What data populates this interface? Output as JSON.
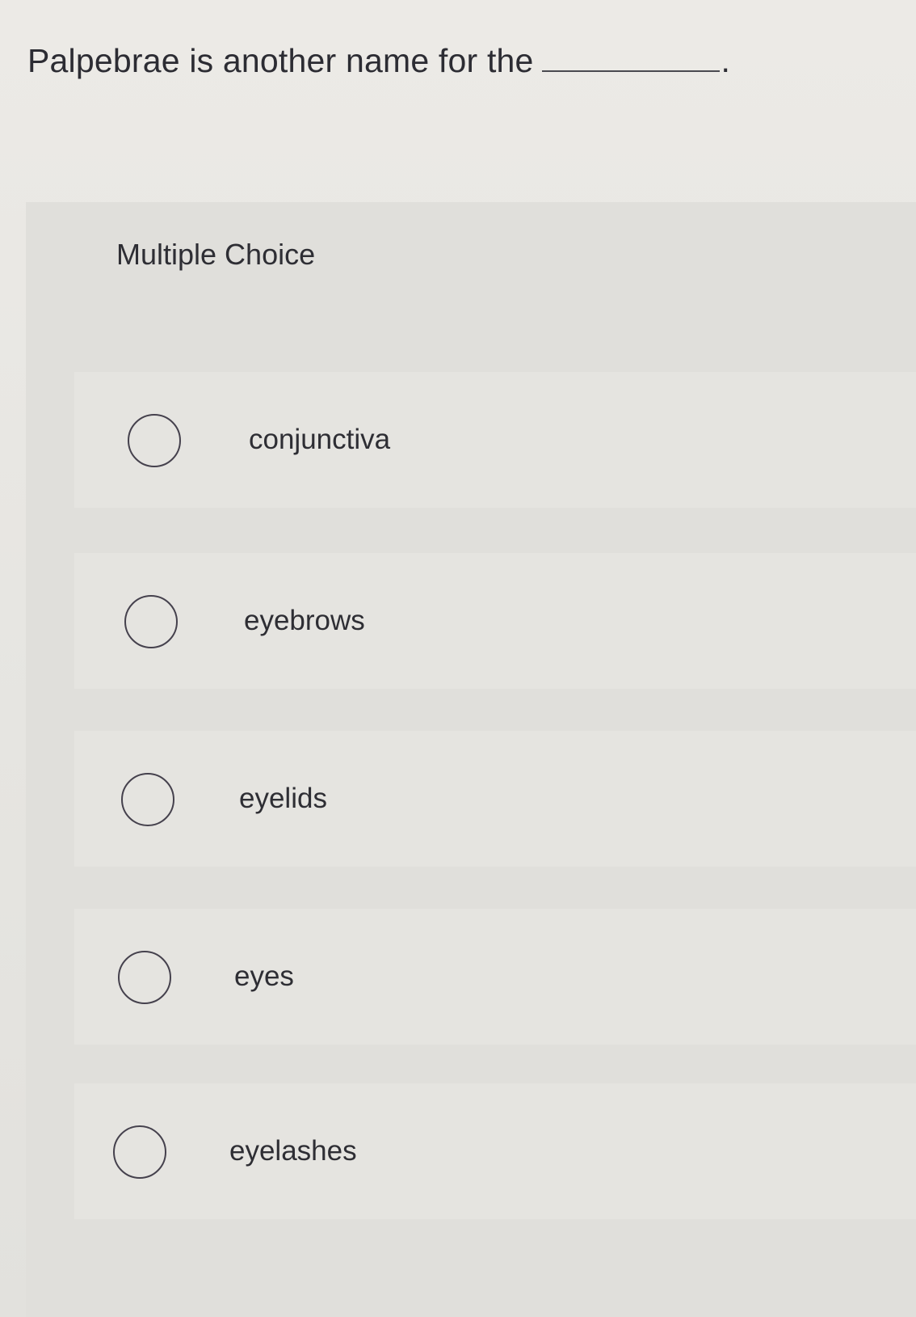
{
  "question": {
    "text": "Palpebrae is another name for the",
    "period": "."
  },
  "choice_label": "Multiple Choice",
  "options": [
    {
      "label": "conjunctiva",
      "selected": false
    },
    {
      "label": "eyebrows",
      "selected": false
    },
    {
      "label": "eyelids",
      "selected": false
    },
    {
      "label": "eyes",
      "selected": false
    },
    {
      "label": "eyelashes",
      "selected": false
    }
  ]
}
